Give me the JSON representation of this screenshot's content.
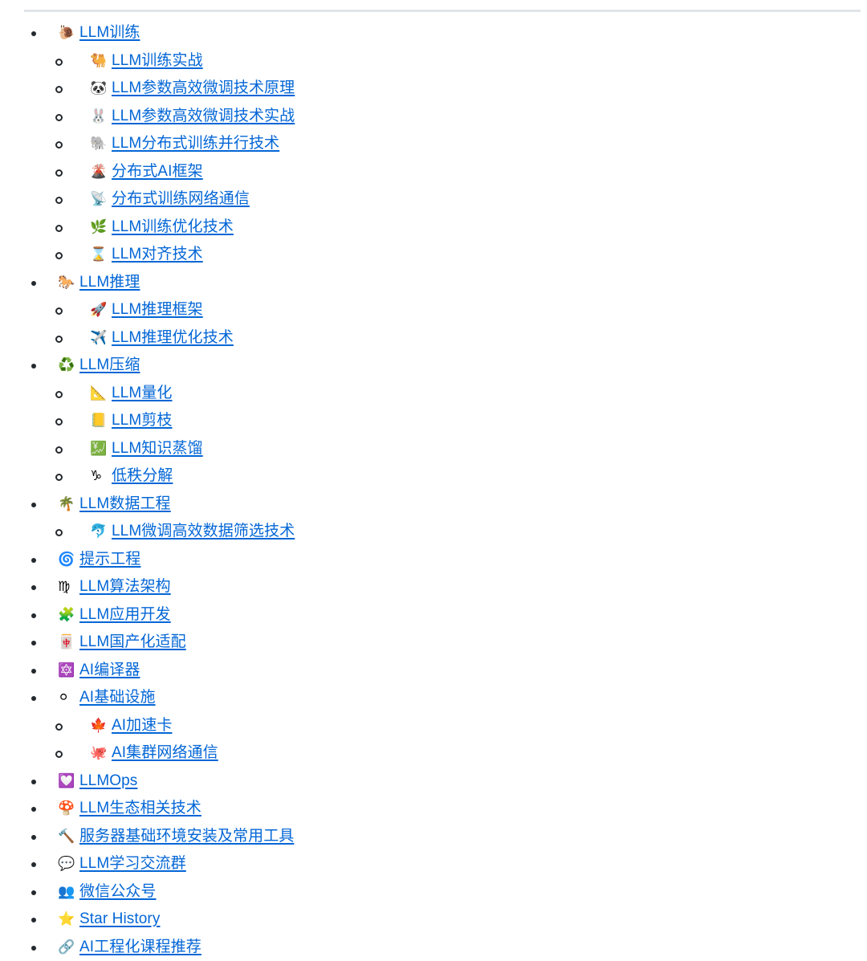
{
  "document": {
    "type": "table-of-contents",
    "link_color": "#0366d6",
    "rule_color": "#e1e4e8",
    "items": [
      {
        "emoji": "🐌",
        "emoji_name": "snail-icon",
        "label": "LLM训练",
        "children": [
          {
            "emoji": "🐫",
            "emoji_name": "two-hump-camel-icon",
            "label": "LLM训练实战"
          },
          {
            "emoji": "🐼",
            "emoji_name": "panda-icon",
            "label": "LLM参数高效微调技术原理"
          },
          {
            "emoji": "🐰",
            "emoji_name": "rabbit-face-icon",
            "label": "LLM参数高效微调技术实战"
          },
          {
            "emoji": "🐘",
            "emoji_name": "elephant-icon",
            "label": "LLM分布式训练并行技术"
          },
          {
            "emoji": "🌋",
            "emoji_name": "volcano-icon",
            "label": "分布式AI框架"
          },
          {
            "emoji": "📡",
            "emoji_name": "satellite-antenna-icon",
            "label": "分布式训练网络通信"
          },
          {
            "emoji": "🌿",
            "emoji_name": "herb-icon",
            "label": "LLM训练优化技术"
          },
          {
            "emoji": "⌛",
            "emoji_name": "hourglass-icon",
            "label": "LLM对齐技术"
          }
        ]
      },
      {
        "emoji": "🐎",
        "emoji_name": "horse-icon",
        "label": "LLM推理",
        "children": [
          {
            "emoji": "🚀",
            "emoji_name": "rocket-icon",
            "label": "LLM推理框架"
          },
          {
            "emoji": "✈️",
            "emoji_name": "airplane-icon",
            "label": "LLM推理优化技术"
          }
        ]
      },
      {
        "emoji": "♻️",
        "emoji_name": "recycling-icon",
        "label": "LLM压缩",
        "children": [
          {
            "emoji": "📐",
            "emoji_name": "triangular-ruler-icon",
            "label": "LLM量化"
          },
          {
            "emoji": "📒",
            "emoji_name": "ledger-icon",
            "label": "LLM剪枝"
          },
          {
            "emoji": "💹",
            "emoji_name": "chart-increasing-yen-icon",
            "label": "LLM知识蒸馏"
          },
          {
            "emoji": "♑",
            "emoji_name": "capricorn-icon",
            "label": "低秩分解"
          }
        ]
      },
      {
        "emoji": "🌴",
        "emoji_name": "palm-tree-icon",
        "label": "LLM数据工程",
        "children": [
          {
            "emoji": "🐬",
            "emoji_name": "dolphin-icon",
            "label": "LLM微调高效数据筛选技术"
          }
        ]
      },
      {
        "emoji": "🌀",
        "emoji_name": "cyclone-icon",
        "label": "提示工程",
        "children": []
      },
      {
        "emoji": "♍",
        "emoji_name": "virgo-icon",
        "label": "LLM算法架构",
        "children": []
      },
      {
        "emoji": "🧩",
        "emoji_name": "puzzle-piece-icon",
        "label": "LLM应用开发",
        "children": []
      },
      {
        "emoji": "🀄",
        "emoji_name": "mahjong-red-dragon-icon",
        "label": "LLM国产化适配",
        "children": []
      },
      {
        "emoji": "🔯",
        "emoji_name": "dotted-six-pointed-star-icon",
        "label": "AI编译器",
        "children": []
      },
      {
        "emoji": "⚪",
        "emoji_name": "white-circle-icon",
        "label": "AI基础设施",
        "children": [
          {
            "emoji": "🍁",
            "emoji_name": "maple-leaf-icon",
            "label": "AI加速卡"
          },
          {
            "emoji": "🐙",
            "emoji_name": "octopus-icon",
            "label": "AI集群网络通信"
          }
        ]
      },
      {
        "emoji": "💟",
        "emoji_name": "heart-decoration-icon",
        "label": "LLMOps",
        "children": []
      },
      {
        "emoji": "🍄",
        "emoji_name": "mushroom-icon",
        "label": "LLM生态相关技术",
        "children": []
      },
      {
        "emoji": "🔨",
        "emoji_name": "hammer-icon",
        "label": "服务器基础环境安装及常用工具",
        "children": []
      },
      {
        "emoji": "💬",
        "emoji_name": "speech-balloon-icon",
        "label": "LLM学习交流群",
        "children": []
      },
      {
        "emoji": "👥",
        "emoji_name": "busts-in-silhouette-icon",
        "label": "微信公众号",
        "children": []
      },
      {
        "emoji": "⭐",
        "emoji_name": "star-icon",
        "label": "Star History",
        "children": []
      },
      {
        "emoji": "🔗",
        "emoji_name": "link-icon",
        "label": "AI工程化课程推荐",
        "children": []
      }
    ]
  }
}
